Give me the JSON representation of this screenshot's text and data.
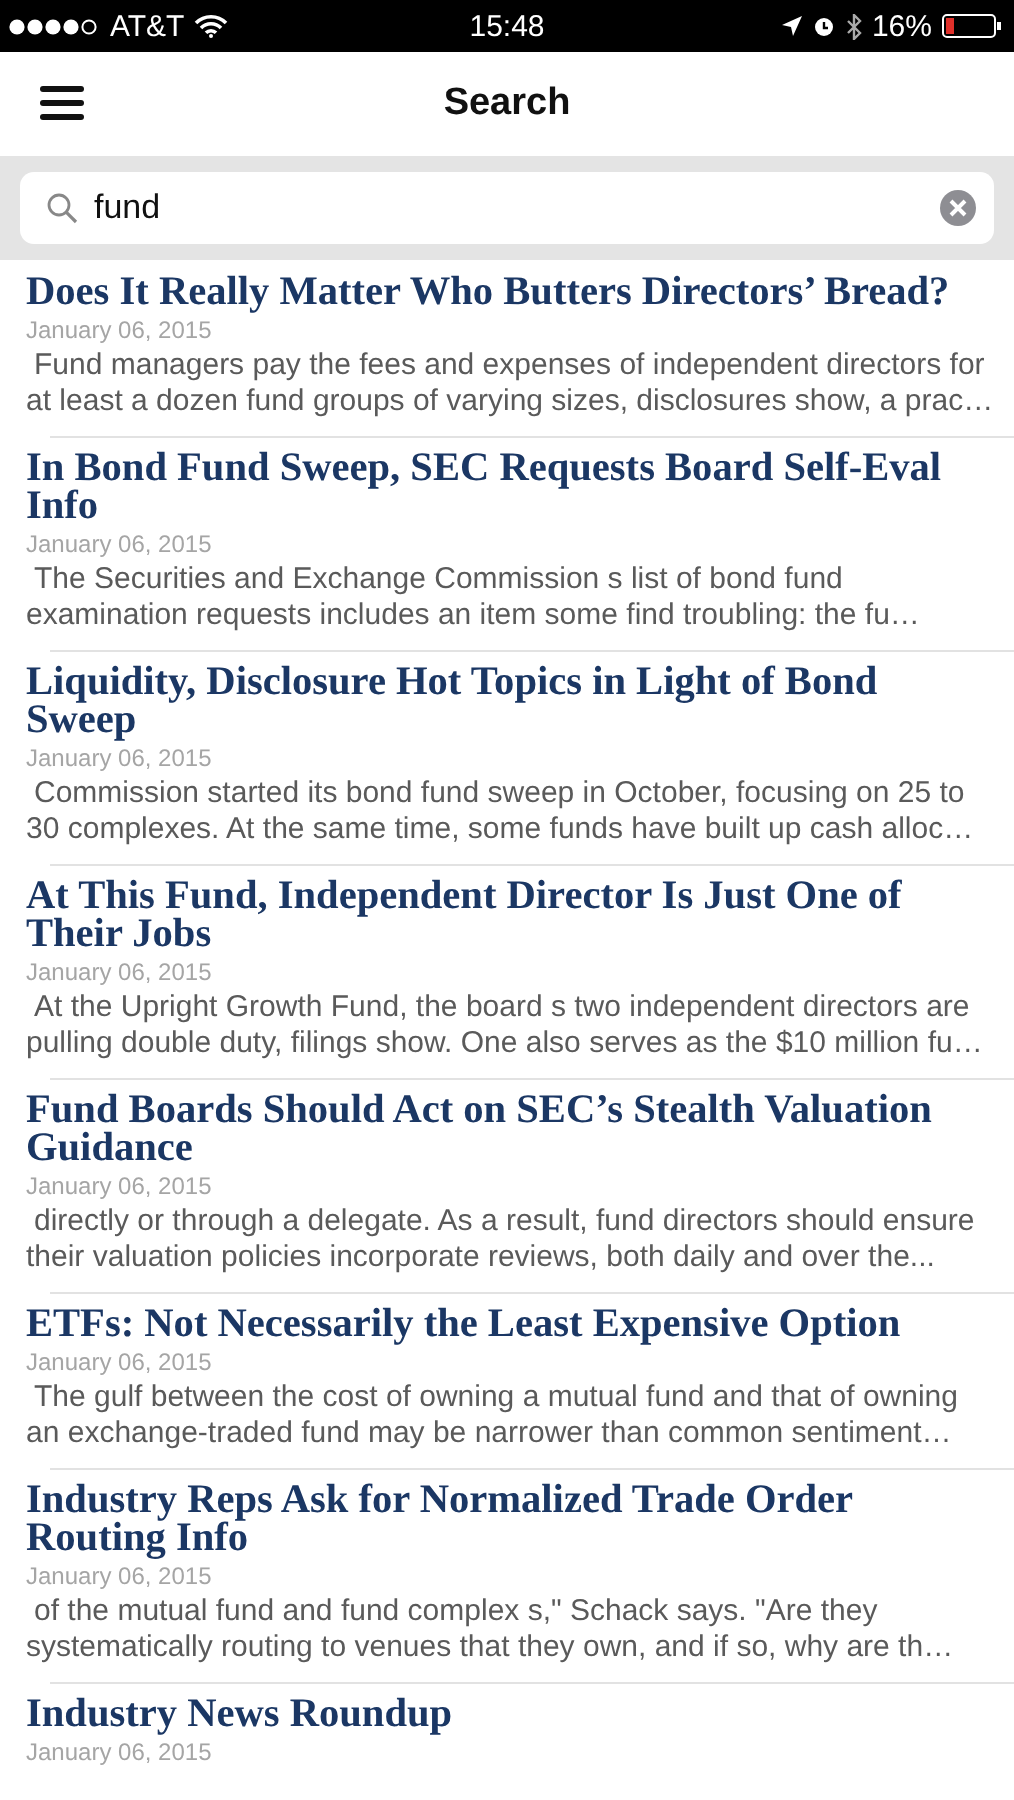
{
  "status_bar": {
    "carrier": "AT&T",
    "time": "15:48",
    "battery": "16%"
  },
  "header": {
    "title": "Search"
  },
  "search": {
    "value": "fund"
  },
  "results": [
    {
      "title": "Does It Really Matter Who Butters Directors’ Bread?",
      "date": "January 06, 2015",
      "snippet": "Fund managers pay the fees and expenses of independent directors for at least a dozen fund groups of varying sizes, disclosures show, a prac…"
    },
    {
      "title": "In Bond Fund Sweep, SEC Requests Board Self-Eval Info",
      "date": "January 06, 2015",
      "snippet": "The Securities and Exchange Commission s list of bond fund examination requests includes an item some find troubling: the fu…"
    },
    {
      "title": "Liquidity, Disclosure Hot Topics in Light of Bond Sweep",
      "date": "January 06, 2015",
      "snippet": "Commission started its bond fund sweep in October, focusing on 25 to 30 complexes. At the same time, some funds have built up cash alloc…"
    },
    {
      "title": "At This Fund, Independent Director Is Just One of Their Jobs",
      "date": "January 06, 2015",
      "snippet": "At the Upright Growth Fund, the board s two independent directors are pulling double duty, filings show. One also serves as the $10 million fu…"
    },
    {
      "title": "Fund Boards Should Act on SEC’s Stealth Valuation Guidance",
      "date": "January 06, 2015",
      "snippet": "directly or through a delegate. As a result, fund directors should ensure their valuation policies incorporate reviews, both daily and over the..."
    },
    {
      "title": "ETFs: Not Necessarily the Least Expensive Option",
      "date": "January 06, 2015",
      "snippet": "The gulf between the cost of owning a mutual fund and that of owning an exchange-traded fund may be narrower than common sentiment…"
    },
    {
      "title": "Industry Reps Ask for Normalized Trade Order Routing Info",
      "date": "January 06, 2015",
      "snippet": "of the mutual fund and fund complex s,\" Schack says. \"Are they systematically routing to venues that they own, and if so, why are th…"
    },
    {
      "title": "Industry News Roundup",
      "date": "January 06, 2015"
    }
  ]
}
